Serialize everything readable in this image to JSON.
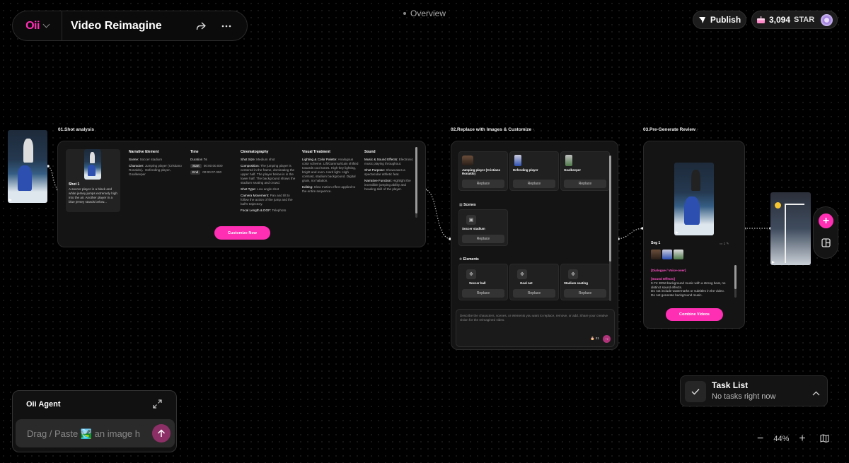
{
  "app": {
    "logo": "Oii",
    "title": "Video Reimagine",
    "overview": "Overview",
    "publish": "Publish",
    "stars": "3,094",
    "stars_unit": "STAR"
  },
  "nodes": {
    "shot_analysis": "01.Shot analysis",
    "replace": "02.Replace with Images & Customize",
    "pregen": "03.Pre-Generate Review"
  },
  "shot": {
    "title": "Shot 1",
    "desc": "A soccer player in a black and white jersey jumps extremely high into the air. Another player in a blue jersey stands below...",
    "columns": {
      "narrative": "Narrative Element",
      "time": "Time",
      "cinema": "Cinematography",
      "visual": "Visual Treatment",
      "sound": "Sound"
    },
    "narrative": {
      "scene_k": "Scene:",
      "scene_v": "Soccer stadium",
      "char_k": "Character:",
      "char_v": "Jumping player (Cristiano Ronaldo)、Defending player、Goalkeeper"
    },
    "time": {
      "duration": "Duration 7s",
      "start_k": "Start",
      "start_v": "00:00:00.000",
      "end_k": "End",
      "end_v": "00:00:07.000"
    },
    "cinema": {
      "size_k": "Shot Size:",
      "size_v": "Medium shot",
      "comp_k": "Composition:",
      "comp_v": "The jumping player is centered in the frame, dominating the upper half. The player below is in the lower half. The background shows the stadium seating and crowd.",
      "type_k": "Shot Type:",
      "type_v": "Low angle shot",
      "move_k": "Camera Movement:",
      "move_v": "Pan and tilt to follow the action of the jump and the ball's trajectory.",
      "focal_k": "Focal Length & DOF:",
      "focal_v": "Telephoto"
    },
    "visual": {
      "light_k": "Lighting & Color Palette:",
      "light_v": "Analogous color scheme. Lift/Gamma/Gain shifted towards cool tones. High-key lighting, bright and even. Hard light. High contrast, stadium background. Digital grain, no halation.",
      "edit_k": "Editing:",
      "edit_v": "Slow motion effect applied to the entire sequence."
    },
    "sound": {
      "music_k": "Music & Sound Effects:",
      "music_v": "Electronic music playing throughout.",
      "purpose_k": "Shot Purpose:",
      "purpose_v": "Showcases a spectacular athletic feat.",
      "func_k": "Narrative Function:",
      "func_v": "Highlight the incredible jumping ability and heading skill of the player."
    },
    "customize": "Customize Now"
  },
  "replace": {
    "characters": [
      {
        "name": "Jumping player (Cristiano Ronaldo)"
      },
      {
        "name": "Defending player"
      },
      {
        "name": "Goalkeeper"
      }
    ],
    "scenes_title": "Scenes",
    "scenes": [
      {
        "name": "Soccer stadium"
      }
    ],
    "elements_title": "Elements",
    "elements": [
      {
        "name": "Soccer ball"
      },
      {
        "name": "Goal net"
      },
      {
        "name": "Stadium seating"
      }
    ],
    "replace_label": "Replace",
    "prompt": "Describe the characters, scenes, or elements you want to replace, remove, or add. Share your creative vision for the reimagined video.",
    "credits": "21"
  },
  "pregen": {
    "seg": "Seg 1",
    "count": "1",
    "dialogue": "[Dialogue / Voice-over]",
    "sfx_title": "[Sound Effects]",
    "sfx": "0-7s: EDM background music with a strong beat, no distinct sound effects.",
    "note1": "Do not include watermarks or subtitles in the video.",
    "note2": "Do not generate background music.",
    "combine": "Combine Videos"
  },
  "task": {
    "title": "Task List",
    "status": "No tasks right now"
  },
  "agent": {
    "title": "Oii Agent",
    "placeholder": "Drag / Paste 🏞️ an image h"
  },
  "zoom": {
    "level": "44%"
  },
  "colors": {
    "accent": "#ff2fb4",
    "bg": "#000000",
    "panel": "#141414"
  }
}
